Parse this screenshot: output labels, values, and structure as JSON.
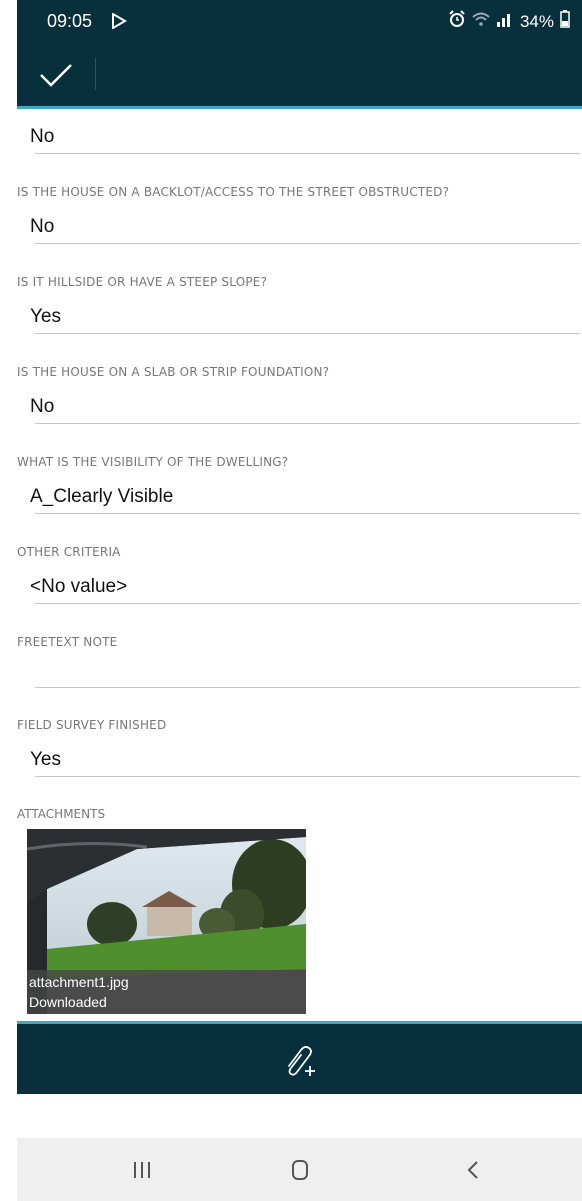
{
  "status_bar": {
    "time": "09:05",
    "battery": "34%"
  },
  "fields": [
    {
      "label": "",
      "value": "No"
    },
    {
      "label": "IS THE HOUSE ON A BACKLOT/ACCESS TO THE STREET OBSTRUCTED?",
      "value": "No"
    },
    {
      "label": "IS IT HILLSIDE OR HAVE A STEEP SLOPE?",
      "value": "Yes"
    },
    {
      "label": "IS THE HOUSE ON A SLAB OR STRIP FOUNDATION?",
      "value": "No"
    },
    {
      "label": "WHAT IS THE VISIBILITY OF THE DWELLING?",
      "value": "A_Clearly Visible"
    },
    {
      "label": "OTHER CRITERIA",
      "value": "<No value>"
    },
    {
      "label": "FREETEXT NOTE",
      "value": ""
    },
    {
      "label": "FIELD SURVEY FINISHED",
      "value": "Yes"
    }
  ],
  "attachments": {
    "label": "ATTACHMENTS",
    "items": [
      {
        "name": "attachment1.jpg",
        "status": "Downloaded"
      }
    ]
  },
  "colors": {
    "bar": "#082f3c",
    "accent": "#3fa6c4"
  },
  "icons": {
    "save": "check-icon",
    "add_attachment": "paperclip-plus-icon",
    "nav_recents": "recents-icon",
    "nav_home": "home-icon",
    "nav_back": "back-icon"
  }
}
